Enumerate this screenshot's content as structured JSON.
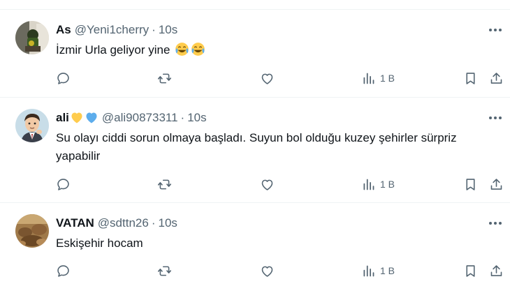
{
  "tweets": [
    {
      "name": "As",
      "handle": "@Yeni1cherry",
      "sep": "·",
      "time": "10s",
      "text": "İzmir Urla geliyor yine",
      "views": "1 B"
    },
    {
      "name": "ali",
      "handle": "@ali90873311",
      "sep": "·",
      "time": "10s",
      "text": "Su olayı ciddi sorun olmaya başladı. Suyun bol olduğu kuzey şehirler sürpriz yapabilir",
      "views": "1 B"
    },
    {
      "name": "VATAN",
      "handle": "@sdttn26",
      "sep": "·",
      "time": "10s",
      "text": "Eskişehir hocam",
      "views": "1 B"
    }
  ],
  "icons": {
    "more": "more-icon",
    "reply": "reply-icon",
    "retweet": "retweet-icon",
    "like": "heart-icon",
    "views": "views-icon",
    "bookmark": "bookmark-icon",
    "share": "share-icon",
    "emoji_laugh": "tears-of-joy-emoji",
    "heart_yellow": "yellow-heart-emoji",
    "heart_blue": "blue-heart-emoji"
  },
  "colors": {
    "text": "#0f1419",
    "secondary": "#536471",
    "divider": "#eff3f4",
    "yellow_heart": "#ffcc4d",
    "blue_heart": "#5dadec"
  }
}
